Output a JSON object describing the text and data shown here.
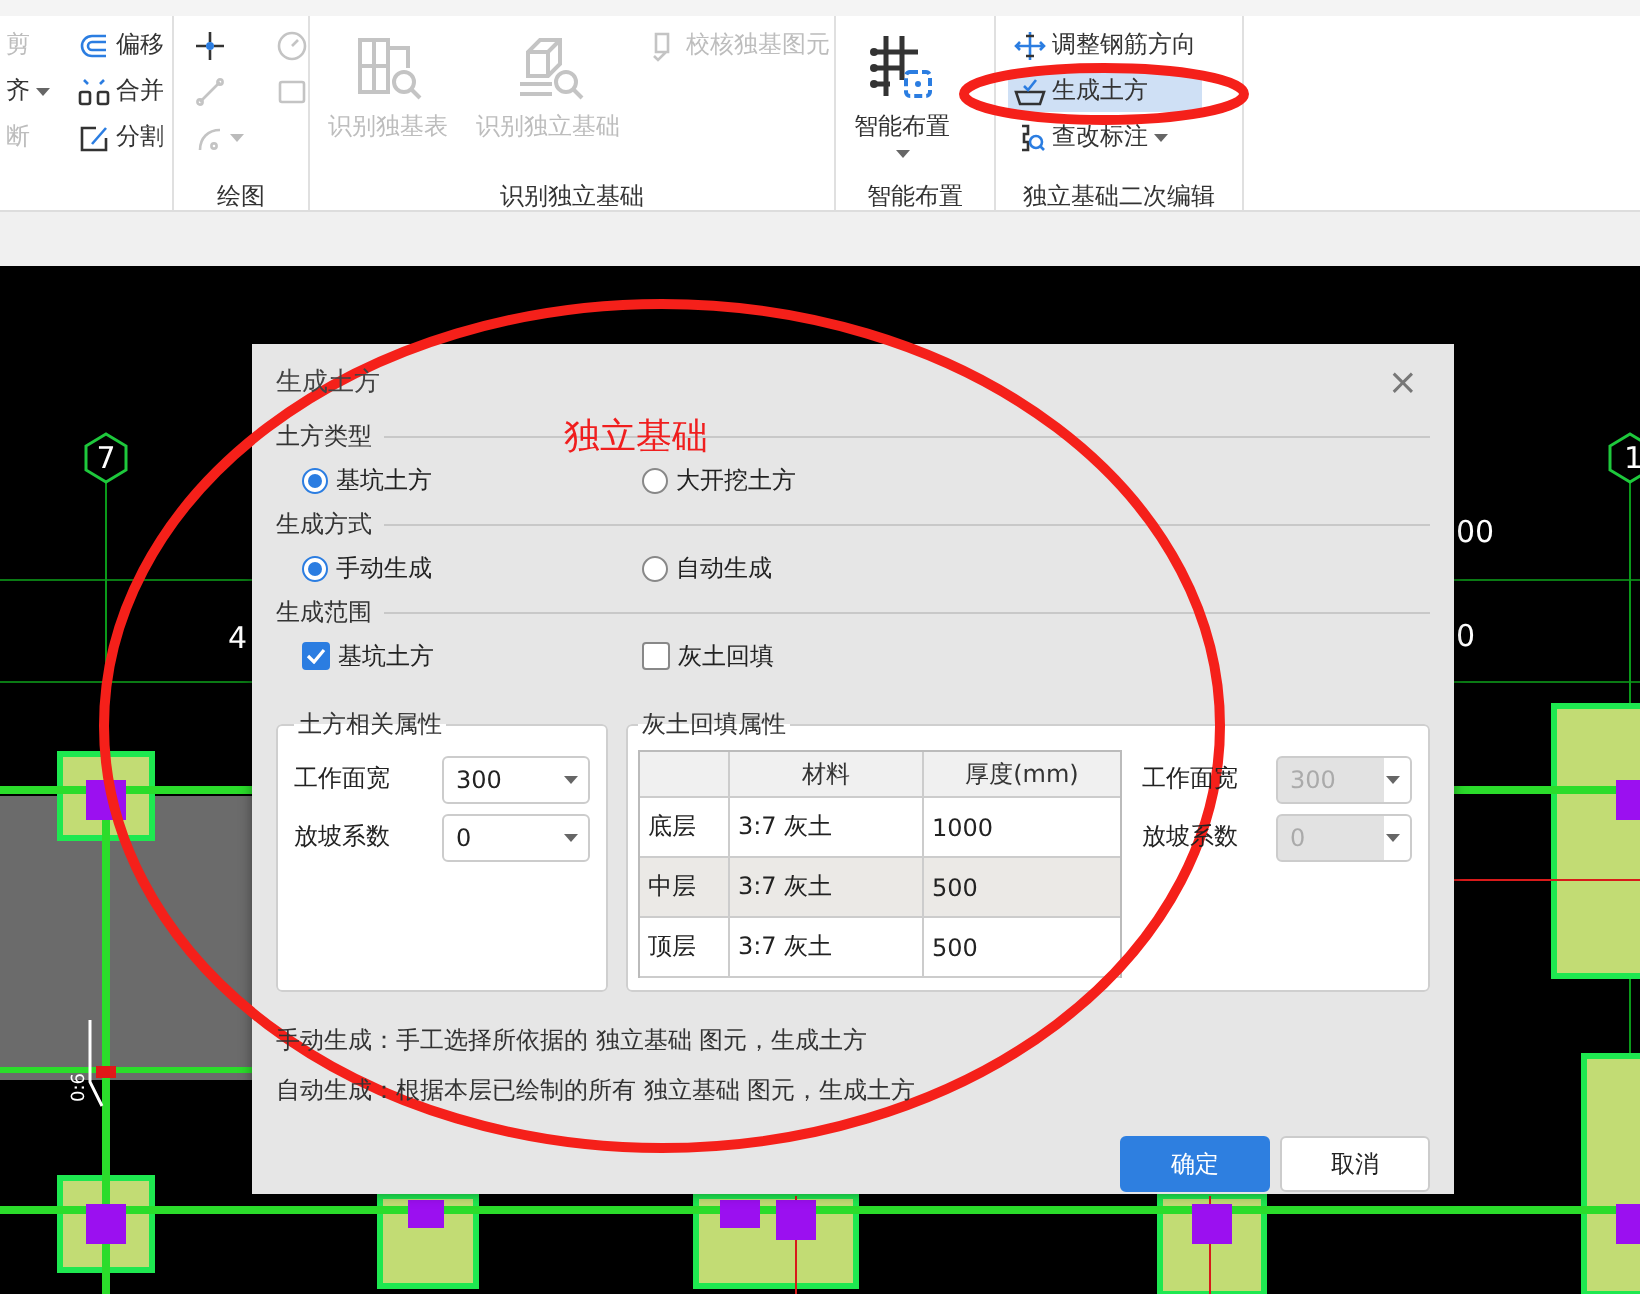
{
  "ribbon": {
    "groups": [
      {
        "items": [
          {
            "kind": "small",
            "label": "剪",
            "disabled": true,
            "dropdown": false,
            "selected": false
          },
          {
            "kind": "small",
            "label": "齐",
            "disabled": false,
            "dropdown": true,
            "selected": false
          },
          {
            "kind": "small",
            "label": "断",
            "disabled": true,
            "dropdown": false,
            "selected": false
          },
          {
            "kind": "small",
            "label": "偏移",
            "disabled": false,
            "dropdown": false,
            "selected": false
          },
          {
            "kind": "small",
            "label": "合并",
            "disabled": false,
            "dropdown": false,
            "selected": false
          },
          {
            "kind": "small",
            "label": "分割",
            "disabled": false,
            "dropdown": false,
            "selected": false
          }
        ]
      },
      {
        "label": "绘图",
        "items": [
          {
            "kind": "icon",
            "disabled": false,
            "dropdown": false,
            "selected": false
          },
          {
            "kind": "icon",
            "disabled": true,
            "dropdown": false,
            "selected": false
          },
          {
            "kind": "icon",
            "disabled": true,
            "dropdown": true,
            "selected": false
          },
          {
            "kind": "icon",
            "disabled": true,
            "dropdown": false,
            "selected": false
          },
          {
            "kind": "icon",
            "disabled": true,
            "dropdown": false,
            "selected": false
          }
        ]
      },
      {
        "label": "识别独立基础",
        "items": [
          {
            "kind": "large",
            "label": "识别独基表",
            "disabled": true,
            "dropdown": false,
            "selected": false
          },
          {
            "kind": "large",
            "label": "识别独立基础",
            "disabled": true,
            "dropdown": false,
            "selected": false
          },
          {
            "kind": "small",
            "label": "校核独基图元",
            "disabled": true,
            "dropdown": false,
            "selected": false
          }
        ]
      },
      {
        "label": "智能布置",
        "items": [
          {
            "kind": "large",
            "label": "智能布置",
            "disabled": false,
            "dropdown": true,
            "selected": false
          }
        ]
      },
      {
        "label": "独立基础二次编辑",
        "items": [
          {
            "kind": "small",
            "label": "调整钢筋方向",
            "disabled": false,
            "dropdown": false,
            "selected": false
          },
          {
            "kind": "small",
            "label": "生成土方",
            "disabled": false,
            "dropdown": false,
            "selected": true
          },
          {
            "kind": "small",
            "label": "查改标注",
            "disabled": false,
            "dropdown": true,
            "selected": false
          }
        ]
      }
    ]
  },
  "canvas": {
    "axis_labels": [
      "7",
      "1"
    ],
    "dimension_texts": [
      "4",
      "00",
      "0"
    ],
    "slope_label": "0:6"
  },
  "dialog": {
    "title": "生成土方",
    "close": "×",
    "sections": [
      {
        "title": "土方类型",
        "kind": "radio",
        "options": [
          {
            "label": "基坑土方",
            "selected": true
          },
          {
            "label": "大开挖土方",
            "selected": false
          }
        ]
      },
      {
        "title": "生成方式",
        "kind": "radio",
        "options": [
          {
            "label": "手动生成",
            "selected": true
          },
          {
            "label": "自动生成",
            "selected": false
          }
        ]
      },
      {
        "title": "生成范围",
        "kind": "checkbox",
        "options": [
          {
            "label": "基坑土方",
            "checked": true
          },
          {
            "label": "灰土回填",
            "checked": false
          }
        ]
      }
    ],
    "earthwork_panel": {
      "title": "土方相关属性",
      "fields": [
        {
          "label": "工作面宽",
          "value": "300",
          "disabled": false
        },
        {
          "label": "放坡系数",
          "value": "0",
          "disabled": false
        }
      ]
    },
    "backfill_panel": {
      "title": "灰土回填属性",
      "columns": [
        "材料",
        "厚度(mm)"
      ],
      "rows": [
        {
          "label": "底层",
          "material": "3:7 灰土",
          "thickness": "1000",
          "selected": false
        },
        {
          "label": "中层",
          "material": "3:7 灰土",
          "thickness": "500",
          "selected": true
        },
        {
          "label": "顶层",
          "material": "3:7 灰土",
          "thickness": "500",
          "selected": false
        }
      ],
      "fields": [
        {
          "label": "工作面宽",
          "value": "300",
          "disabled": true
        },
        {
          "label": "放坡系数",
          "value": "0",
          "disabled": true
        }
      ]
    },
    "notes": [
      "手动生成：手工选择所依据的 独立基础 图元，生成土方",
      "自动生成：根据本层已绘制的所有 独立基础 图元，生成土方"
    ],
    "buttons": [
      {
        "label": "确定",
        "kind": "primary"
      },
      {
        "label": "取消",
        "kind": "secondary"
      }
    ]
  },
  "annotation": {
    "label": "独立基础"
  }
}
